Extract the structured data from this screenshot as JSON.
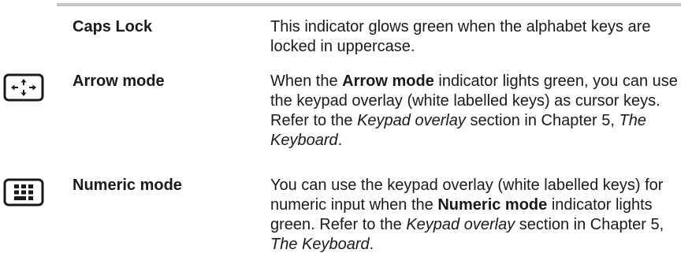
{
  "rows": [
    {
      "term": "Caps Lock",
      "icon": "",
      "desc": {
        "text": "This indicator glows green when the alphabet keys are locked in uppercase."
      }
    },
    {
      "term": "Arrow mode",
      "icon": "arrow-mode-icon",
      "desc": {
        "p1": "When the ",
        "b1": "Arrow mode",
        "p2": " indicator lights green, you can use the keypad overlay (white labelled keys) as cursor keys. Refer to the ",
        "i1": "Keypad overlay",
        "p3": " section in Chapter 5, ",
        "i2": "The Keyboard",
        "p4": "."
      }
    },
    {
      "term": "Numeric mode",
      "icon": "numeric-mode-icon",
      "desc": {
        "p1": "You can use the keypad overlay (white labelled keys) for numeric input when the ",
        "b1": "Numeric mode",
        "p2": " indicator lights green. Refer to the ",
        "i1": "Keypad overlay",
        "p3": " section in Chapter 5, ",
        "i2": "The Keyboard",
        "p4": "."
      }
    }
  ],
  "colors": {
    "rule": "#c4c4c4",
    "text": "#1a1a1a"
  }
}
